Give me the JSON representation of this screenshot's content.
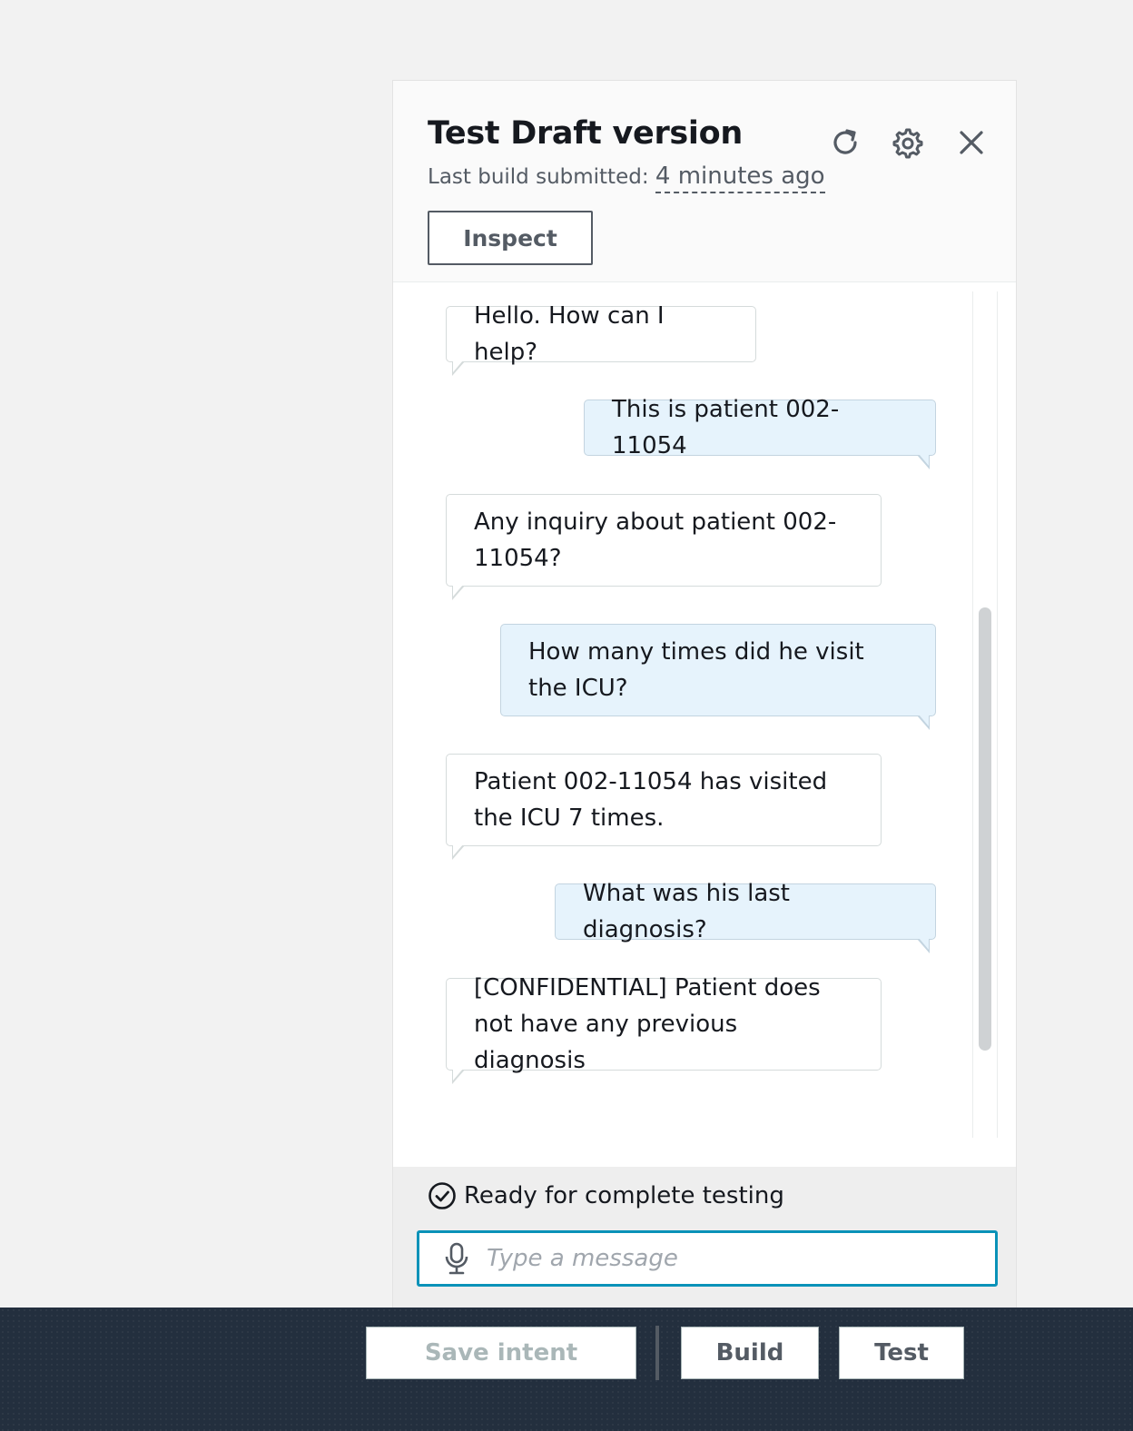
{
  "panel": {
    "title": "Test Draft version",
    "build_label": "Last build submitted:",
    "build_time": "4 minutes ago",
    "inspect_label": "Inspect",
    "icons": [
      "refresh-icon",
      "gear-icon",
      "close-icon"
    ]
  },
  "chat": {
    "messages": [
      {
        "sender": "bot",
        "text": "Hello. How can I help?"
      },
      {
        "sender": "user",
        "text": "This is patient 002-11054"
      },
      {
        "sender": "bot",
        "text": "Any inquiry about patient 002-11054?"
      },
      {
        "sender": "user",
        "text": "How many times did he visit the ICU?"
      },
      {
        "sender": "bot",
        "text": "Patient 002-11054 has visited the ICU 7 times."
      },
      {
        "sender": "user",
        "text": "What was his last diagnosis?"
      },
      {
        "sender": "bot",
        "text": "[CONFIDENTIAL] Patient does not have any previous diagnosis"
      }
    ]
  },
  "footer": {
    "status": "Ready for complete testing",
    "input_placeholder": "Type a message",
    "input_value": ""
  },
  "bottom_bar": {
    "save_intent": "Save intent",
    "build": "Build",
    "test": "Test"
  },
  "colors": {
    "user_bubble": "#e6f3fc",
    "input_focus_border": "#0a92b8",
    "bottom_bar": "#232f3e"
  }
}
